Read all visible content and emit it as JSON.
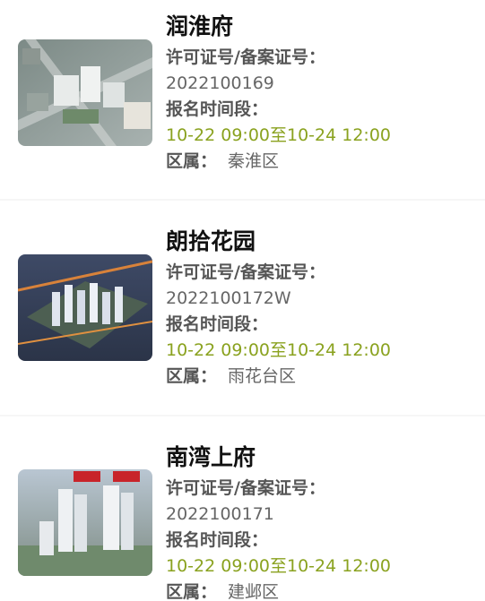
{
  "listings": [
    {
      "name": "润淮府",
      "license_label": "许可证号/备案证号：",
      "license_no": "2022100169",
      "signup_label": "报名时间段：",
      "signup_time": "10-22 09:00至10-24 12:00",
      "district_label": "区属：",
      "district": "秦淮区"
    },
    {
      "name": "朗拾花园",
      "license_label": "许可证号/备案证号：",
      "license_no": "2022100172W",
      "signup_label": "报名时间段：",
      "signup_time": "10-22 09:00至10-24 12:00",
      "district_label": "区属：",
      "district": "雨花台区"
    },
    {
      "name": "南湾上府",
      "license_label": "许可证号/备案证号：",
      "license_no": "2022100171",
      "signup_label": "报名时间段：",
      "signup_time": "10-22 09:00至10-24 12:00",
      "district_label": "区属：",
      "district": "建邺区"
    }
  ],
  "colors": {
    "title": "#111111",
    "label": "#555555",
    "value": "#666666",
    "time": "#8aa21f",
    "separator": "#f6f6f6",
    "card_bg": "#ffffff"
  }
}
